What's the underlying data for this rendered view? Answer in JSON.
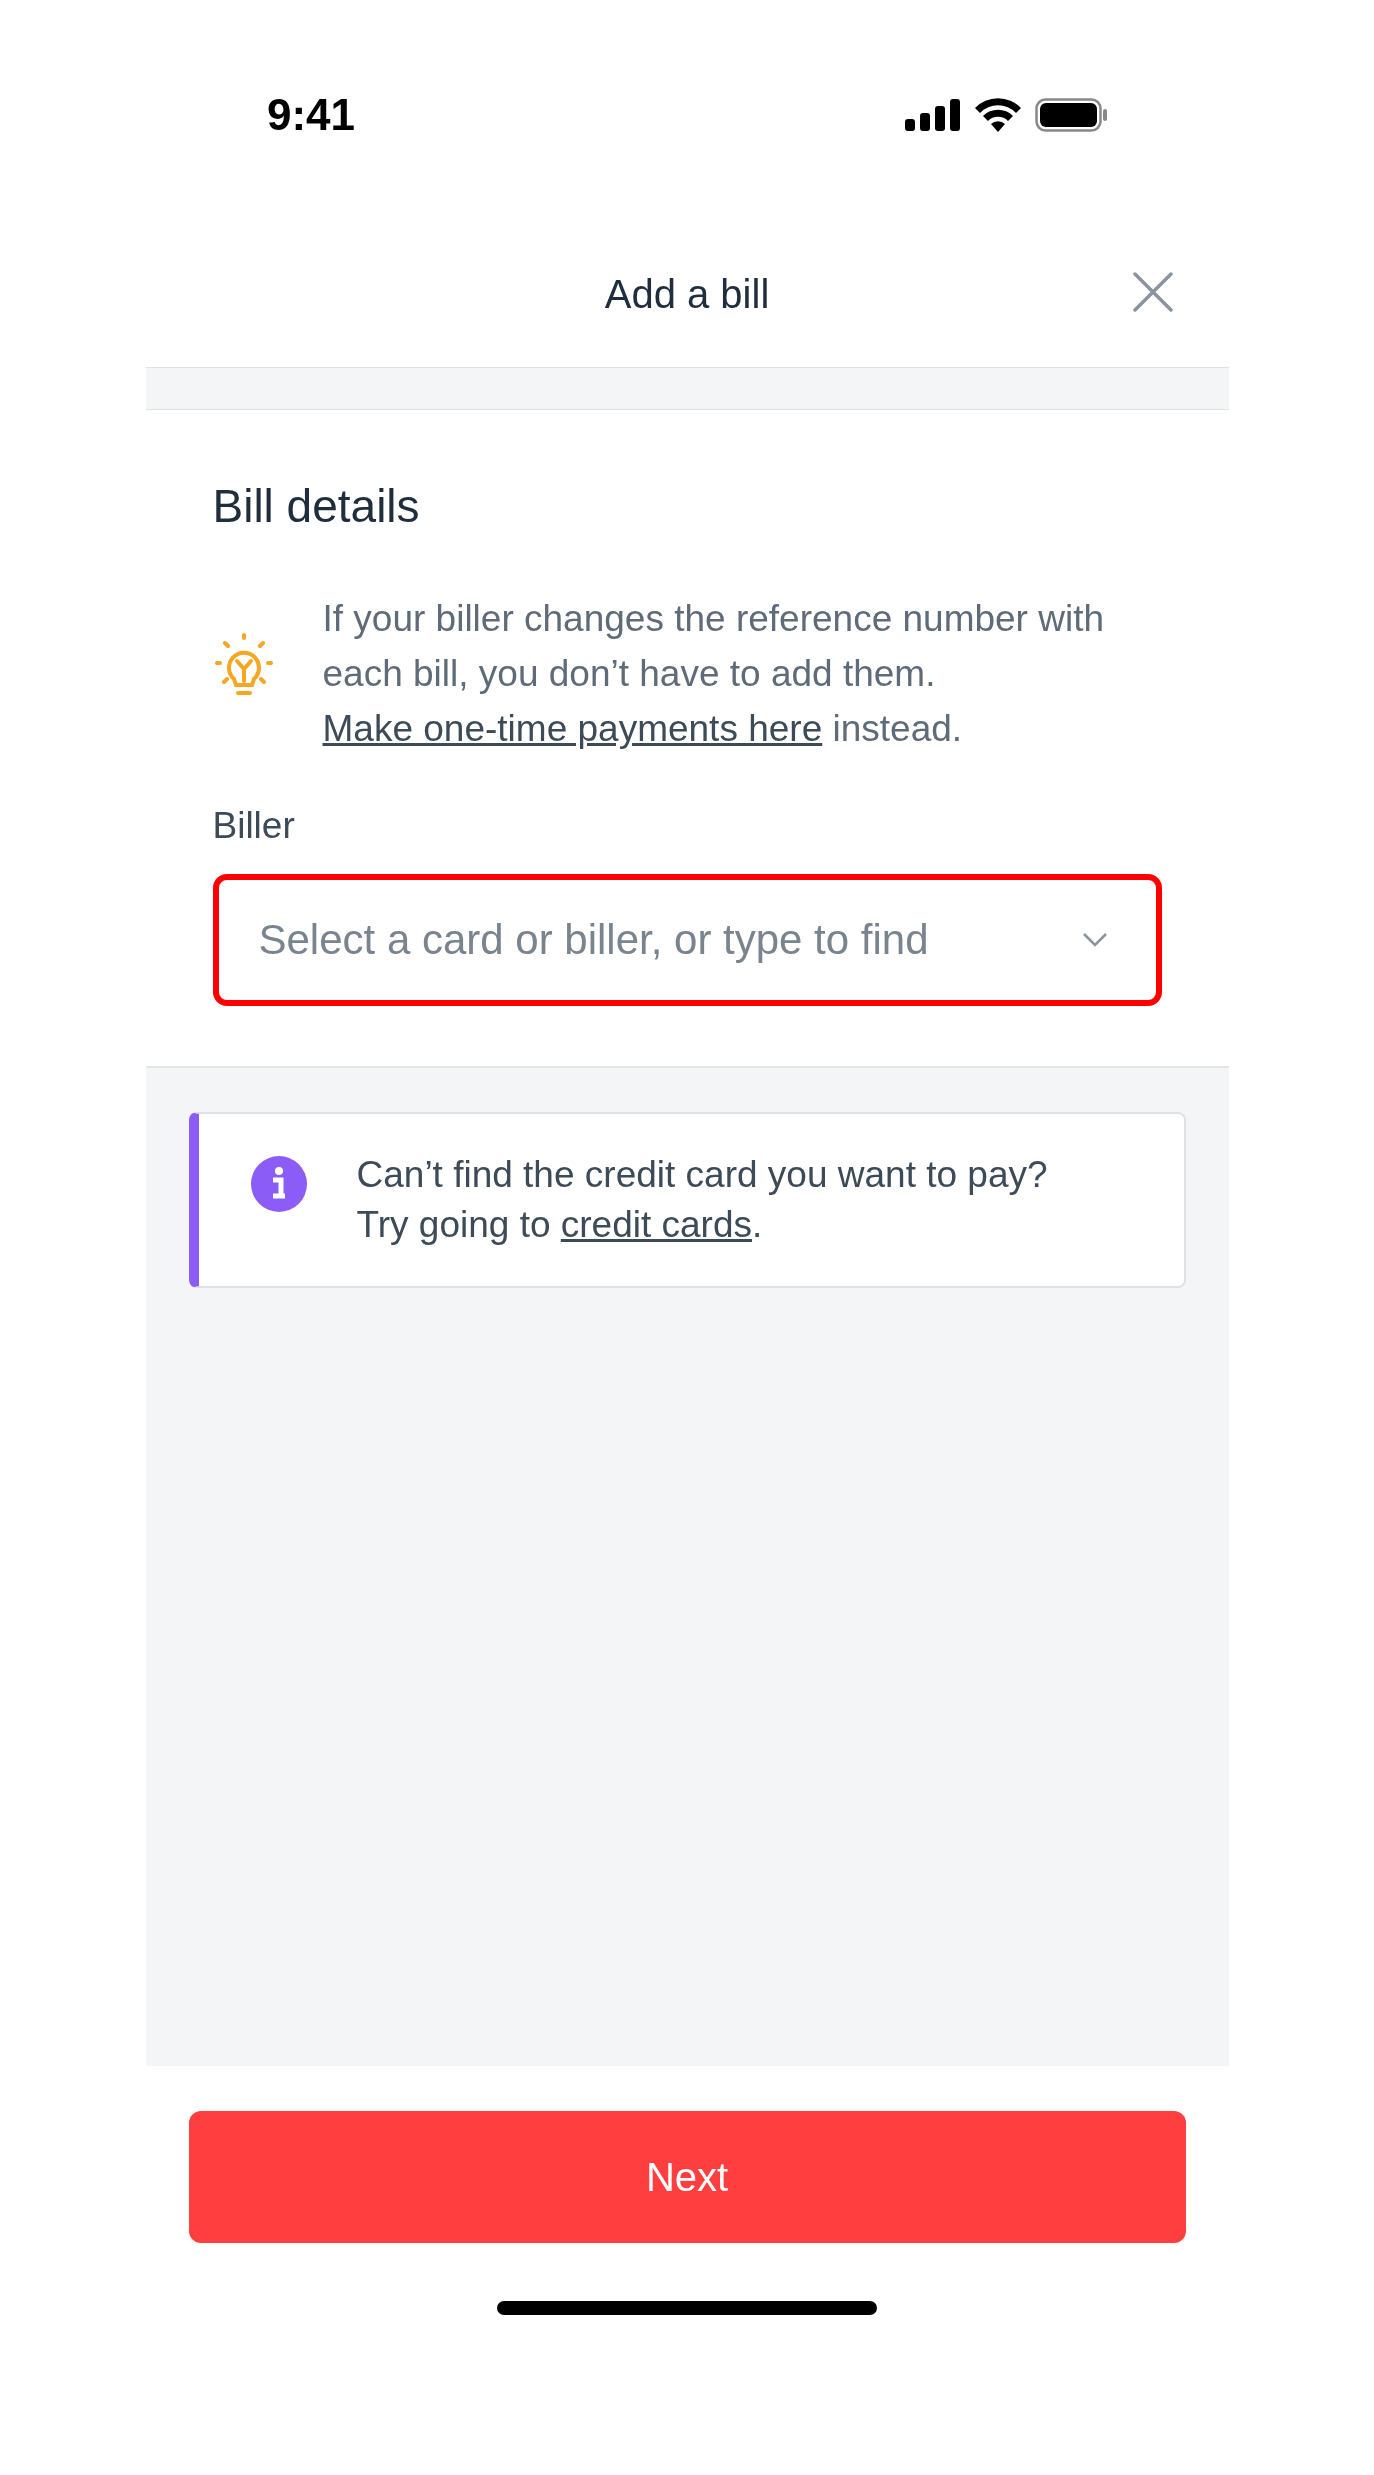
{
  "status_bar": {
    "time": "9:41"
  },
  "header": {
    "title": "Add a bill"
  },
  "section": {
    "title": "Bill details"
  },
  "tip": {
    "text": "If your biller changes the reference number with each bill, you don’t have to add them.",
    "link": "Make one-time payments here",
    "suffix": " instead."
  },
  "biller": {
    "label": "Biller",
    "placeholder": "Select a card or biller, or type to find",
    "highlighted": true
  },
  "notice": {
    "line1": "Can’t find the credit card you want to pay?",
    "prefix": "Try going to ",
    "link": "credit cards",
    "suffix": "."
  },
  "buttons": [
    {
      "label": "Next"
    }
  ]
}
